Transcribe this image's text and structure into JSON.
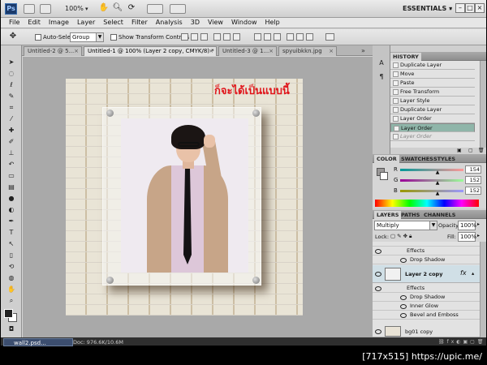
{
  "app": {
    "logo": "Ps",
    "zoom": "100%",
    "workspace": "ESSENTIALS"
  },
  "menu": [
    "File",
    "Edit",
    "Image",
    "Layer",
    "Select",
    "Filter",
    "Analysis",
    "3D",
    "View",
    "Window",
    "Help"
  ],
  "options": {
    "auto_select_label": "Auto-Select:",
    "auto_select_value": "Group",
    "show_transform_label": "Show Transform Controls"
  },
  "tabs": [
    {
      "label": "Untitled-2 @ 5..."
    },
    {
      "label": "Untitled-1 @ 100% (Layer 2 copy, CMYK/8) *"
    },
    {
      "label": "Untitled-3 @ 1..."
    },
    {
      "label": "spyuibkkn.jpg"
    }
  ],
  "canvas": {
    "title_text": "ก็จะได้เป็นแบบนี้"
  },
  "history": {
    "tabs": [
      "HISTORY"
    ],
    "items": [
      {
        "label": "Duplicate Layer",
        "state": "normal"
      },
      {
        "label": "Move",
        "state": "normal"
      },
      {
        "label": "Paste",
        "state": "normal"
      },
      {
        "label": "Free Transform",
        "state": "normal"
      },
      {
        "label": "Layer Style",
        "state": "normal"
      },
      {
        "label": "Duplicate Layer",
        "state": "normal"
      },
      {
        "label": "Layer Order",
        "state": "normal"
      },
      {
        "label": "Layer Order",
        "state": "selected"
      },
      {
        "label": "Layer Order",
        "state": "ghost"
      }
    ]
  },
  "color_panel": {
    "tabs": [
      "COLOR",
      "SWATCHES",
      "STYLES"
    ],
    "r_label": "R",
    "g_label": "G",
    "b_label": "B",
    "r": "154",
    "g": "152",
    "b": "152",
    "r_fraction": 0.6,
    "g_fraction": 0.6,
    "b_fraction": 0.6
  },
  "layers_panel": {
    "tabs": [
      "LAYERS",
      "PATHS",
      "CHANNELS"
    ],
    "blend_mode": "Multiply",
    "opacity_label": "Opacity:",
    "opacity": "100%",
    "lock_label": "Lock:",
    "fill_label": "Fill:",
    "fill": "100%",
    "top_effects_label": "Effects",
    "top_effect": "Drop Shadow",
    "selected_layer": "Layer 2 copy",
    "fx_label": "fx",
    "effects_label": "Effects",
    "effects": [
      "Drop Shadow",
      "Inner Glow",
      "Bevel and Emboss"
    ],
    "bottom_layer": "bg01 copy"
  },
  "taskbar": {
    "file": "wall2.psd...",
    "doc_status": "Doc: 976.6K/10.6M",
    "watermark": "[717x515] https://upic.me/"
  },
  "colors": {
    "accent_selected_row": "#8fb5a9",
    "title_red": "#e0141a"
  }
}
